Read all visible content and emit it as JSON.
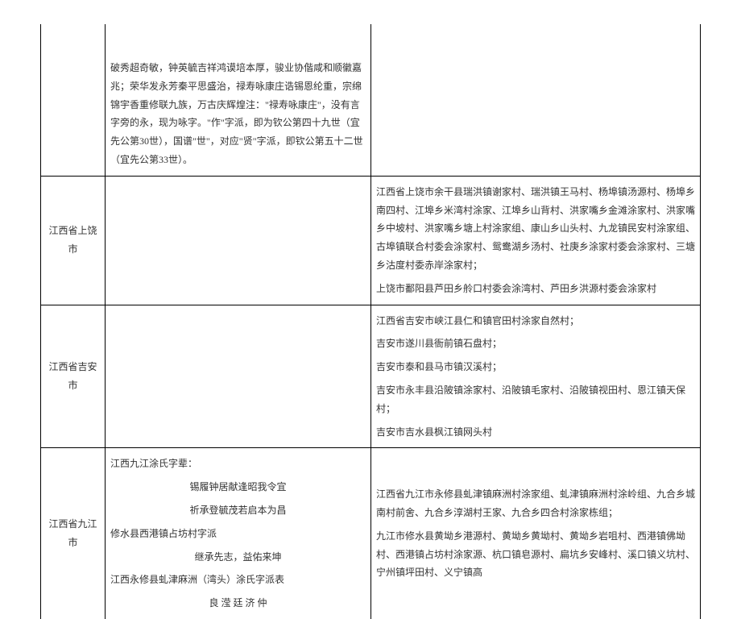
{
  "rows": [
    {
      "col1": "",
      "col2": "破秀超奇敏，钟英毓吉祥鸿谟培本厚，骏业协偕咸和顺徽嘉兆；荣华发永芳秦平思盛治，禄寿咏康庄诰锡恩纶重，宗绵锦宇香重修联九族，万古庆辉煌注：\"禄寿咏康庄\"，没有言字旁的永，现为咏字。\"作\"字派，即为钦公第四十九世（宜先公第30世），国谱\"世\"，对应\"贤\"字派，即钦公第五十二世（宜先公第33世）。",
      "col3": ""
    },
    {
      "col1": "江西省上饶市",
      "col2": "",
      "col3_p1": "江西省上饶市余干县瑞洪镇谢家村、瑞洪镇王马村、杨埠镇汤源村、杨埠乡南四村、江埠乡米湾村涂家、江埠乡山背村、洪家嘴乡金滩涂家村、洪家嘴乡中坡村、洪家嘴乡塘上村涂家组、康山乡山头村、九龙镇民安村涂家组、古埠镇联合村委会涂家村、鸳鸯湖乡汤村、社庚乡涂家村委会涂家村、三塘乡沽度村委赤岸涂家村；",
      "col3_p2": "上饶市鄱阳县芦田乡舲口村委会涂湾村、芦田乡洪源村委会涂家村"
    },
    {
      "col1": "江西省吉安市",
      "col2": "",
      "col3_p1": "江西省吉安市峡江县仁和镇官田村涂家自然村；",
      "col3_p2": "吉安市遂川县衙前镇石盘村；",
      "col3_p3": "吉安市泰和县马市镇汉溪村；",
      "col3_p4": "吉安市永丰县沿陂镇涂家村、沿陂镇毛家村、沿陂镇视田村、恩江镇天保村；",
      "col3_p5": "吉安市吉水县枫江镇网头村"
    },
    {
      "col1": "江西省九江市",
      "col2_p1": "江西九江涂氏字辈：",
      "col2_p2": "锡履钟居献逢昭我令宜",
      "col2_p3": "祈承登毓茂若启本为昌",
      "col2_p4": "修水县西港镇占坊村字派",
      "col2_p5": "继承先志，益佑来坤",
      "col2_p6": "江西永修县虬津麻洲（湾头）涂氏字派表",
      "col2_p7": "良 滢 廷 济 仲",
      "col3_p1": "江西省九江市永修县虬津镇麻洲村涂家组、虬津镇麻洲村涂岭组、九合乡城南村前舍、九合乡淳湖村王家、九合乡四合村涂家栋组；",
      "col3_p2": "九江市修水县黄坳乡港源村、黄坳乡黄坳村、黄坳乡岩咀村、西港镇佛坳村、西港镇占坊村涂家源、杭口镇皂源村、扁坑乡安峰村、溪口镇义坑村、宁州镇坪田村、义宁镇高"
    }
  ]
}
